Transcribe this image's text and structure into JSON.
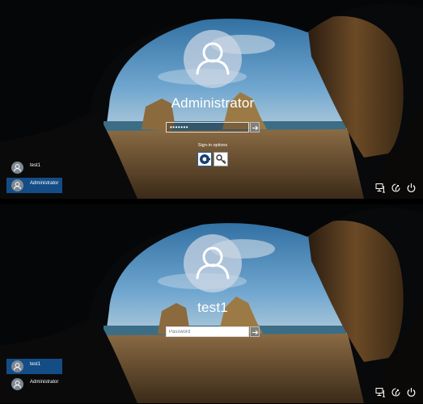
{
  "screens": [
    {
      "username": "Administrator",
      "password_value": "•••••••",
      "signin_options_label": "Sign-in options",
      "users": [
        {
          "name": "test1",
          "selected": false
        },
        {
          "name": "Administrator",
          "selected": true
        }
      ]
    },
    {
      "username": "test1",
      "password_placeholder": "Password",
      "users": [
        {
          "name": "test1",
          "selected": true
        },
        {
          "name": "Administrator",
          "selected": false
        }
      ]
    }
  ],
  "icons": {
    "avatar": "person-icon",
    "submit": "arrow-right-icon",
    "signin_option_1": "smartcard-icon",
    "signin_option_2": "key-icon",
    "network": "network-icon",
    "ease_of_access": "ease-of-access-icon",
    "power": "power-icon"
  },
  "colors": {
    "selected_user": "#144d86",
    "avatar_circle": "#cdd7e4"
  }
}
